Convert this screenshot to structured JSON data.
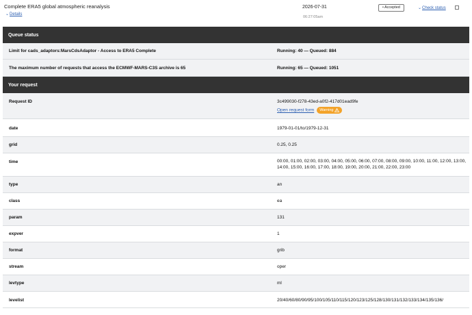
{
  "header": {
    "title": "Complete ERA5 global atmospheric reanalysis",
    "details_label": "Details",
    "date": "2026-07-31",
    "time": "06:27:05am",
    "status_badge": "Accepted",
    "check_status_label": "Check status"
  },
  "queue": {
    "section_title": "Queue status",
    "rows": [
      {
        "label": "Limit for cads_adaptors:MarsCdsAdaptor - Access to ERA5 Complete",
        "value": "Running: 40 — Queued: 884"
      },
      {
        "label": "The maximum number of requests that access the ECMWF-MARS-C3S archive is 65",
        "value": "Running: 65 — Queued: 1051"
      }
    ]
  },
  "request": {
    "section_title": "Your request",
    "request_id_label": "Request ID",
    "request_id": "3c499030-f278-43ed-a0f2-417d01ead9fe",
    "open_form_label": "Open request form",
    "warning_label": "Warning",
    "params": [
      {
        "label": "date",
        "value": "1979-01-01/to/1979-12-31"
      },
      {
        "label": "grid",
        "value": "0.25, 0.25"
      },
      {
        "label": "time",
        "value": "00:00, 01:00, 02:00, 03:00, 04:00, 05:00, 06:00, 07:00, 08:00, 09:00, 10:00, 11:00, 12:00, 13:00, 14:00, 15:00, 16:00, 17:00, 18:00, 19:00, 20:00, 21:00, 22:00, 23:00"
      },
      {
        "label": "type",
        "value": "an"
      },
      {
        "label": "class",
        "value": "ea"
      },
      {
        "label": "param",
        "value": "131"
      },
      {
        "label": "expver",
        "value": "1"
      },
      {
        "label": "format",
        "value": "grib"
      },
      {
        "label": "stream",
        "value": "oper"
      },
      {
        "label": "levtype",
        "value": "ml"
      },
      {
        "label": "levelist",
        "value": "20/40/60/80/90/95/100/105/110/115/120/123/125/128/130/131/132/133/134/135/136/"
      }
    ]
  },
  "colors": {
    "section_bar": "#333333",
    "row_shade": "#f1f2f4",
    "link": "#2a5db0",
    "warning": "#f3a32a"
  }
}
